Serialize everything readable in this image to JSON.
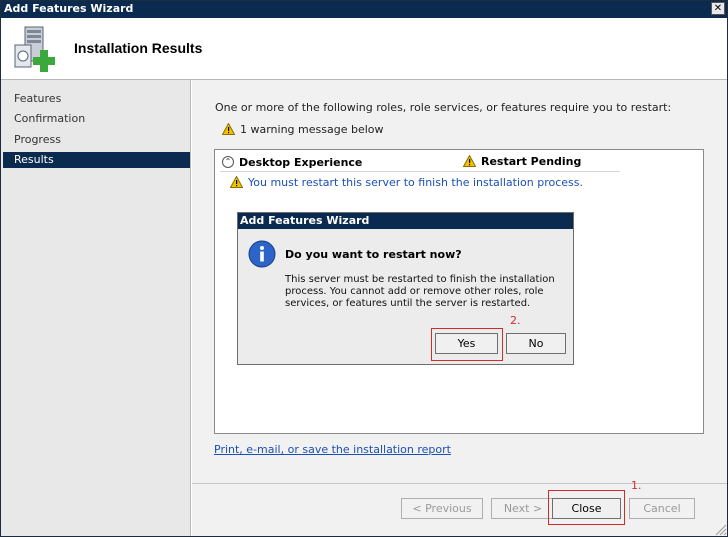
{
  "window": {
    "title": "Add Features Wizard",
    "close_glyph": "✕"
  },
  "header": {
    "title": "Installation Results",
    "icon": "server-add-icon"
  },
  "sidebar": {
    "items": [
      {
        "label": "Features"
      },
      {
        "label": "Confirmation"
      },
      {
        "label": "Progress"
      },
      {
        "label": "Results",
        "active": true
      }
    ]
  },
  "content": {
    "intro": "One or more of the following roles, role services, or features require you to restart:",
    "warning_summary": "1 warning message below",
    "result": {
      "name": "Desktop Experience",
      "status": "Restart Pending",
      "message": "You must restart this server to finish the installation process."
    },
    "report_link": "Print, e-mail, or save the installation report"
  },
  "dialog": {
    "title": "Add Features Wizard",
    "question": "Do you want to restart now?",
    "body": "This server must be restarted to finish the installation process. You cannot add or remove other roles, role services, or features until the server is restarted.",
    "yes_label": "Yes",
    "no_label": "No"
  },
  "buttons": {
    "previous": "< Previous",
    "next": "Next >",
    "close": "Close",
    "cancel": "Cancel"
  },
  "annotations": {
    "step1": "1.",
    "step2": "2."
  },
  "colors": {
    "title_bar": "#0b2a4f",
    "link": "#1a4fb5",
    "annotation": "#d42a2a",
    "warning": "#f2c200"
  }
}
